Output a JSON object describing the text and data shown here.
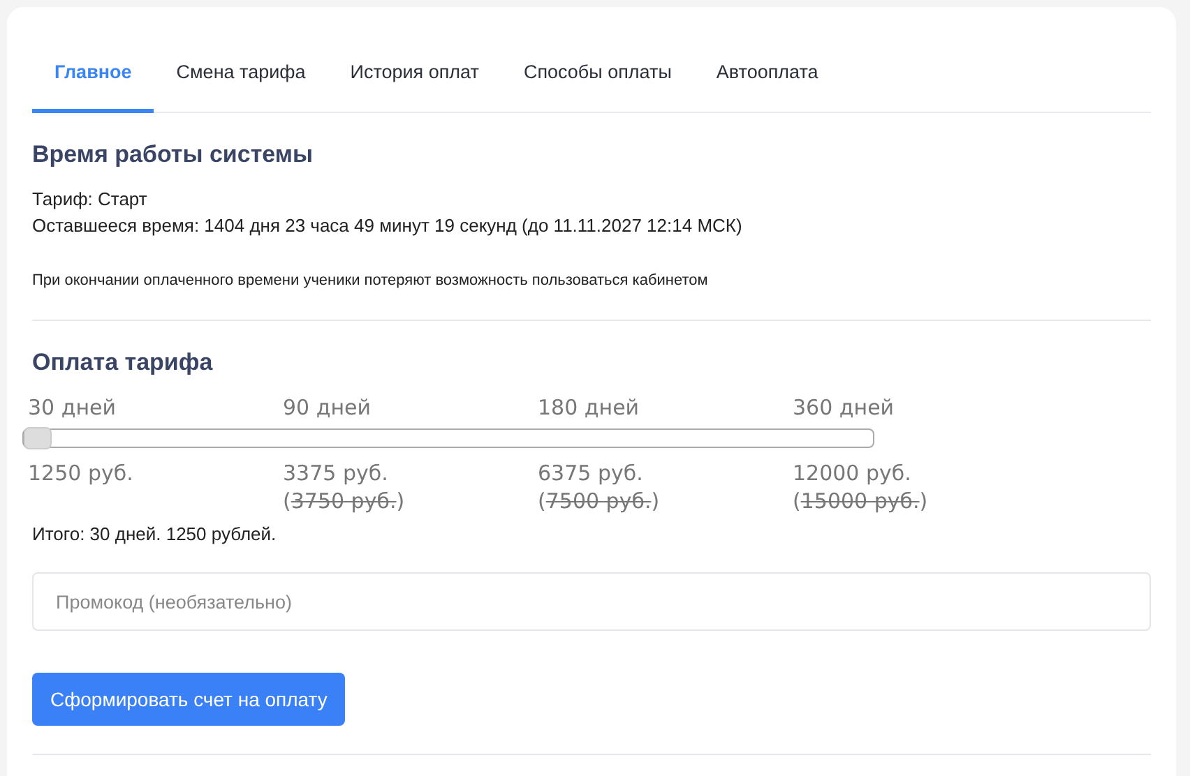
{
  "tabs": [
    {
      "label": "Главное",
      "selected": true
    },
    {
      "label": "Смена тарифа",
      "selected": false
    },
    {
      "label": "История оплат",
      "selected": false
    },
    {
      "label": "Способы оплаты",
      "selected": false
    },
    {
      "label": "Автооплата",
      "selected": false
    }
  ],
  "system": {
    "title": "Время работы системы",
    "tariff": "Тариф: Старт",
    "remaining": "Оставшееся время: 1404 дня 23 часа 49 минут 19 секунд (до 11.11.2027 12:14 МСК)",
    "note": "При окончании оплаченного времени ученики потеряют возможность пользоваться кабинетом"
  },
  "payment": {
    "title": "Оплата тарифа",
    "options": [
      {
        "days": "30 дней",
        "price": "1250 руб."
      },
      {
        "days": "90 дней",
        "price": "3375 руб.",
        "old_price": {
          "before": "(",
          "struck": "3750 руб.",
          "after": ")"
        }
      },
      {
        "days": "180 дней",
        "price": "6375 руб.",
        "old_price": {
          "before": "(",
          "struck": "7500 руб.",
          "after": ")"
        }
      },
      {
        "days": "360 дней",
        "price": "12000 руб.",
        "old_price": {
          "before": "(",
          "struck": "15000 руб.",
          "after": ")"
        }
      }
    ],
    "slider": {
      "level": 0
    },
    "total": "Итого: 30 дней. 1250 рублей.",
    "promo": {
      "placeholder": "Промокод (необязательно)"
    },
    "button": "Сформировать счет на оплату"
  }
}
